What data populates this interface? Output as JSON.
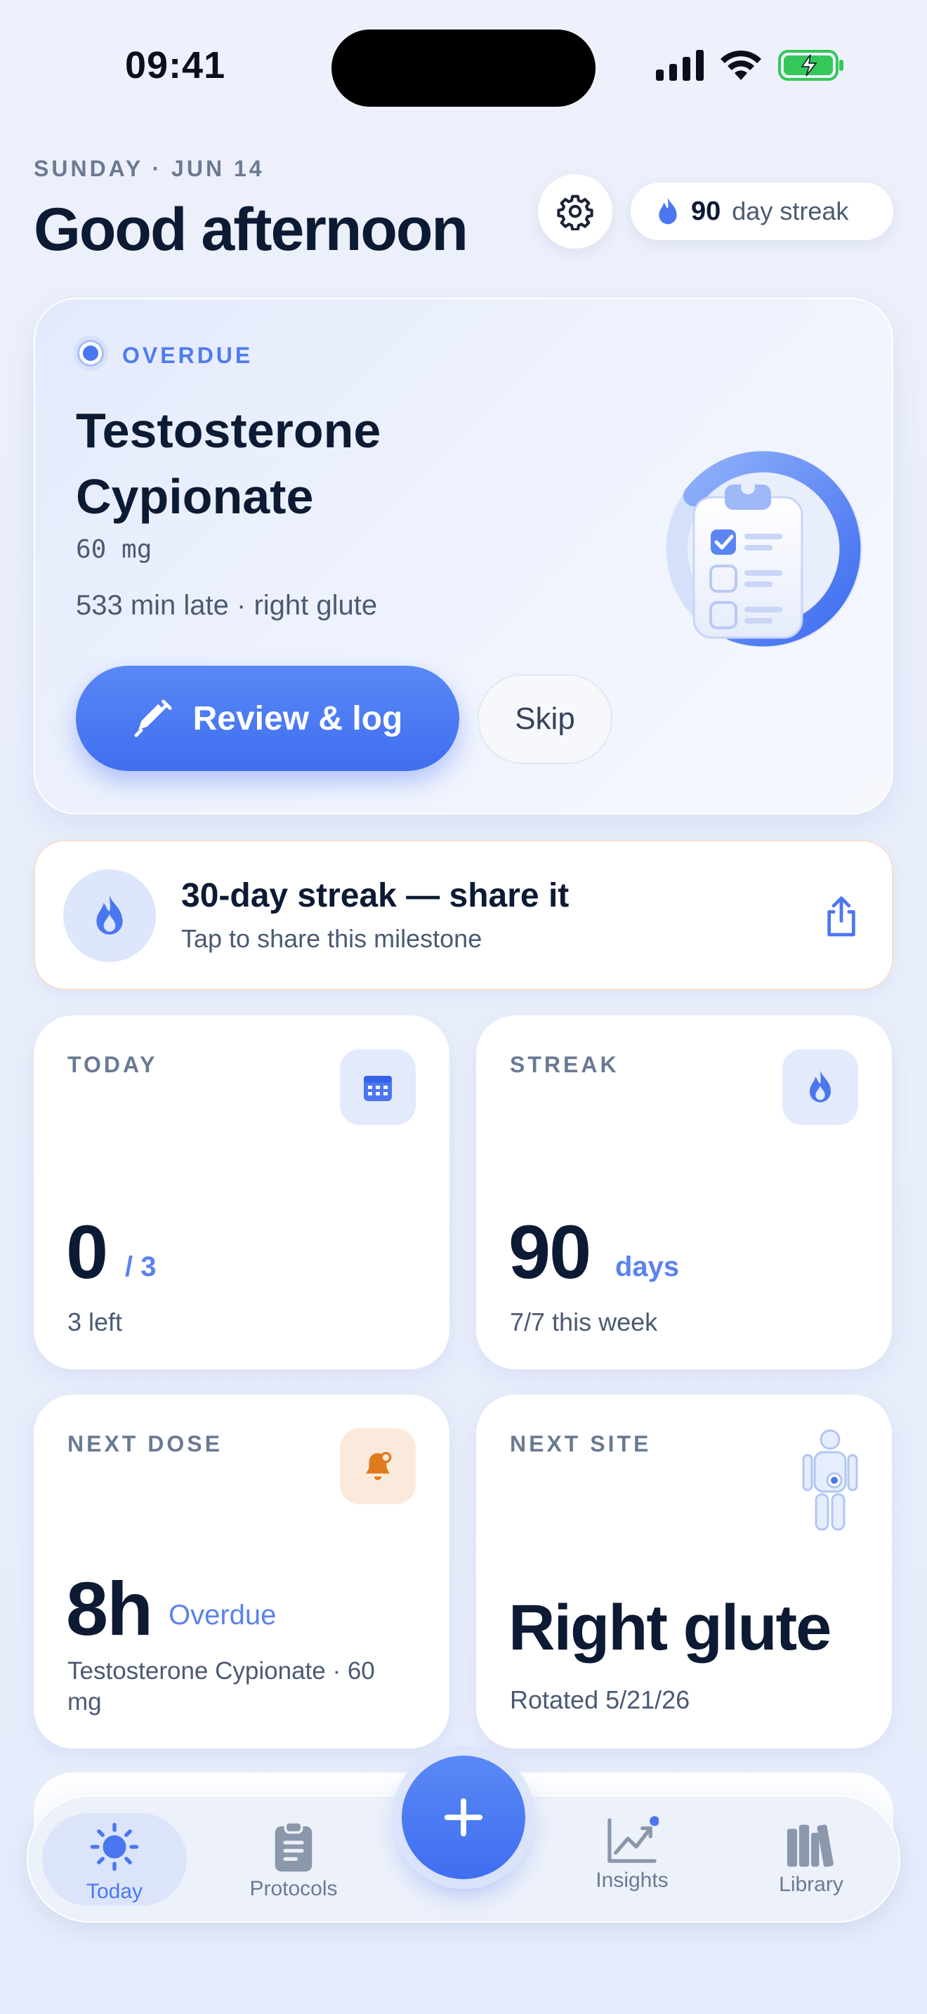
{
  "status_bar": {
    "time": "09:41"
  },
  "header": {
    "date": "SUNDAY · JUN 14",
    "greeting": "Good afternoon",
    "streak_count": "90",
    "streak_label": "day streak"
  },
  "hero": {
    "status": "OVERDUE",
    "medication": "Testosterone Cypionate",
    "dose": "60 mg",
    "late_text": "533 min late · right glute",
    "primary_button": "Review & log",
    "secondary_button": "Skip"
  },
  "share_banner": {
    "title": "30-day streak — share it",
    "subtitle": "Tap to share this milestone"
  },
  "cards": {
    "today": {
      "label": "TODAY",
      "value": "0",
      "total": "/ 3",
      "sub": "3 left"
    },
    "streak": {
      "label": "STREAK",
      "value": "90",
      "unit": "days",
      "sub": "7/7 this week"
    },
    "next_dose": {
      "label": "NEXT DOSE",
      "value": "8h",
      "status": "Overdue",
      "sub": "Testosterone Cypionate · 60 mg"
    },
    "next_site": {
      "label": "NEXT SITE",
      "value": "Right glute",
      "sub": "Rotated 5/21/26"
    }
  },
  "tabs": [
    {
      "label": "Today",
      "icon": "sun-icon",
      "active": true
    },
    {
      "label": "Protocols",
      "icon": "clipboard-icon"
    },
    {
      "label": "Insights",
      "icon": "chart-icon"
    },
    {
      "label": "Library",
      "icon": "books-icon"
    }
  ],
  "colors": {
    "accent": "#4a77f0",
    "text_primary": "#0d1a33",
    "text_secondary": "#4b5a73",
    "warning": "#e07a1e",
    "battery": "#34c759"
  }
}
